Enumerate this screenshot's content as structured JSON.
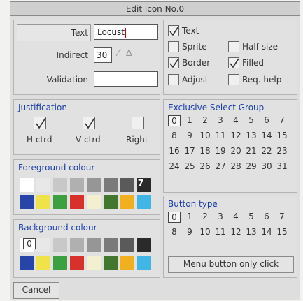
{
  "window": {
    "title": "Edit icon No.0"
  },
  "fields": {
    "text_label": "Text",
    "text_value": "Locust",
    "indirect_label": "Indirect",
    "indirect_value": "30",
    "validation_label": "Validation",
    "validation_value": ""
  },
  "flags": {
    "text": {
      "label": "Text",
      "checked": true
    },
    "sprite": {
      "label": "Sprite",
      "checked": false
    },
    "half_size": {
      "label": "Half size",
      "checked": false
    },
    "border": {
      "label": "Border",
      "checked": true
    },
    "filled": {
      "label": "Filled",
      "checked": true
    },
    "adjust": {
      "label": "Adjust",
      "checked": false
    },
    "req_help": {
      "label": "Req. help",
      "checked": false
    }
  },
  "justification": {
    "title": "Justification",
    "h_ctrd": {
      "label": "H ctrd",
      "checked": true
    },
    "v_ctrd": {
      "label": "V ctrd",
      "checked": true
    },
    "right": {
      "label": "Right",
      "checked": false
    }
  },
  "foreground": {
    "title": "Foreground colour",
    "selected_label": "7",
    "row1": [
      "#ffffff",
      "#e8e8e8",
      "#c8c8c8",
      "#b0b0b0",
      "#969696",
      "#7a7a7a",
      "#5a5a5a",
      "#2a2a2a"
    ],
    "row2": [
      "#2744a8",
      "#efe24a",
      "#3aa040",
      "#d8302a",
      "#f2f0cf",
      "#43762f",
      "#f0b020",
      "#3fb6e6"
    ]
  },
  "background": {
    "title": "Background colour",
    "selected_label": "0",
    "row1": [
      "#ffffff",
      "#e8e8e8",
      "#c8c8c8",
      "#b0b0b0",
      "#969696",
      "#7a7a7a",
      "#5a5a5a",
      "#2a2a2a"
    ],
    "row2": [
      "#2744a8",
      "#efe24a",
      "#3aa040",
      "#d8302a",
      "#f2f0cf",
      "#43762f",
      "#f0b020",
      "#3fb6e6"
    ]
  },
  "esg": {
    "title": "Exclusive Select Group",
    "selected": "0",
    "rows": [
      [
        "0",
        "1",
        "2",
        "3",
        "4",
        "5",
        "6",
        "7"
      ],
      [
        "8",
        "9",
        "10",
        "11",
        "12",
        "13",
        "14",
        "15"
      ],
      [
        "16",
        "17",
        "18",
        "19",
        "20",
        "21",
        "22",
        "23"
      ],
      [
        "24",
        "25",
        "26",
        "27",
        "28",
        "29",
        "30",
        "31"
      ]
    ]
  },
  "button_type": {
    "title": "Button type",
    "selected": "0",
    "rows": [
      [
        "0",
        "1",
        "2",
        "3",
        "4",
        "5",
        "6",
        "7"
      ],
      [
        "8",
        "9",
        "10",
        "11",
        "12",
        "13",
        "14",
        "15"
      ]
    ],
    "description": "Menu button only click"
  },
  "actions": {
    "cancel_label": "Cancel"
  },
  "colors": {
    "accent": "#1a3fa8",
    "caret": "#cc0000"
  }
}
